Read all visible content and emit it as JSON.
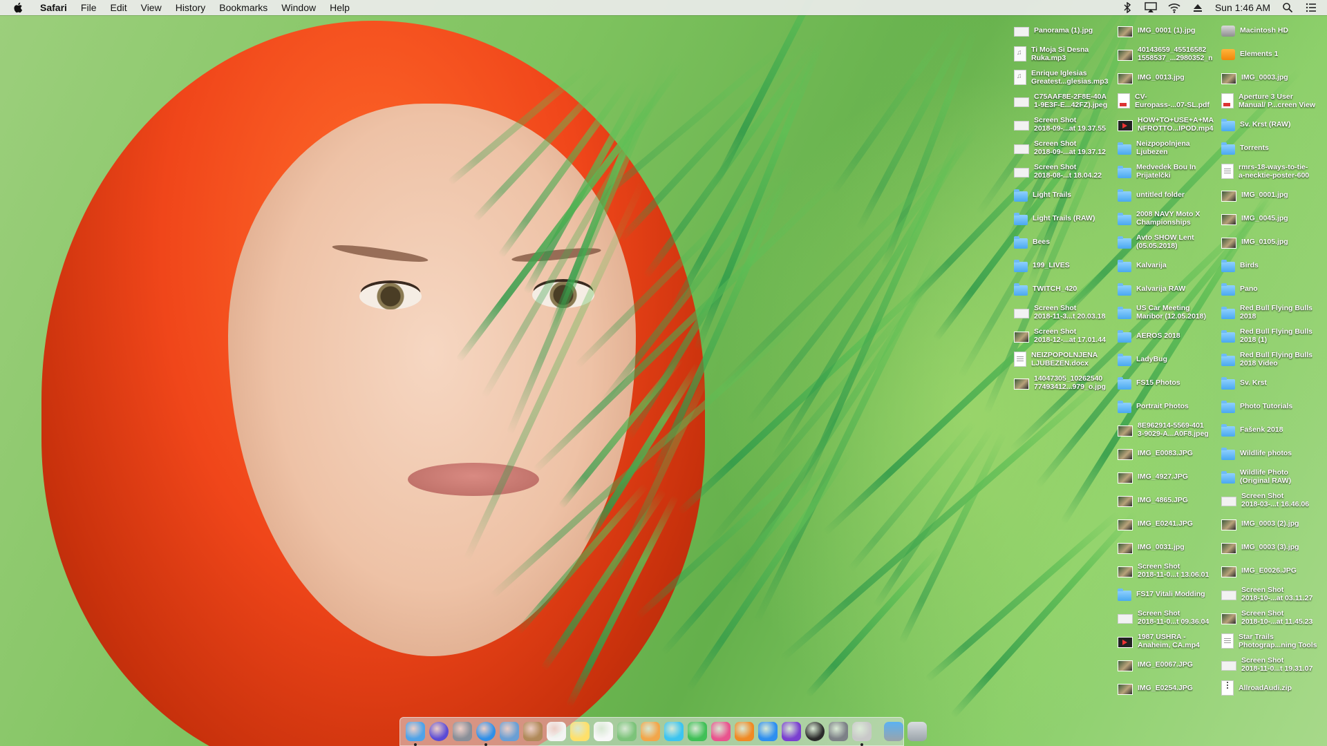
{
  "menubar": {
    "apple_icon": "apple-icon",
    "app_name": "Safari",
    "menus": [
      "File",
      "Edit",
      "View",
      "History",
      "Bookmarks",
      "Window",
      "Help"
    ],
    "status_icons": [
      "bluetooth-icon",
      "airplay-icon",
      "wifi-icon",
      "eject-icon",
      "spotlight-icon",
      "notification-center-icon"
    ],
    "clock": "Sun 1:46 AM"
  },
  "desktop": {
    "col1": [
      {
        "label": "Panorama (1).jpg",
        "icon": "shot"
      },
      {
        "label": "Ti Moja Si Desna\nRuka.mp3",
        "icon": "audio"
      },
      {
        "label": "Enrique Iglesias\nGreatest...glesias.mp3",
        "icon": "audio"
      },
      {
        "label": "C75AAF8E-2F8E-40A\n1-9E3F-E...42FZ).jpeg",
        "icon": "shot"
      },
      {
        "label": "Screen Shot\n2018-09-...at 19.37.55",
        "icon": "shot"
      },
      {
        "label": "Screen Shot\n2018-09-...at 19.37.12",
        "icon": "shot"
      },
      {
        "label": "Screen Shot\n2018-08-...t 18.04.22",
        "icon": "shot"
      },
      {
        "label": "Light Trails",
        "icon": "folder"
      },
      {
        "label": "Light Trails (RAW)",
        "icon": "folder"
      },
      {
        "label": "Bees",
        "icon": "folder"
      },
      {
        "label": "199_LIVES",
        "icon": "folder"
      },
      {
        "label": "TWITCH_420",
        "icon": "folder"
      },
      {
        "label": "Screen Shot\n2018-11-3...t 20.03.18",
        "icon": "shot"
      },
      {
        "label": "Screen Shot\n2018-12-...at 17.01.44",
        "icon": "image"
      },
      {
        "label": "NEIZPOPOLNJENA\nLJUBEZEN.docx",
        "icon": "doc"
      },
      {
        "label": "14047305_10262540\n77493412...979_o.jpg",
        "icon": "image"
      }
    ],
    "col2": [
      {
        "label": "IMG_0001 (1).jpg",
        "icon": "image"
      },
      {
        "label": "40143659_45516582\n1558537_...2980352_n",
        "icon": "image"
      },
      {
        "label": "IMG_0013.jpg",
        "icon": "image"
      },
      {
        "label": "CV-\nEuropass-...07-SL.pdf",
        "icon": "pdf"
      },
      {
        "label": "HOW+TO+USE+A+MA\nNFROTTO...IPOD.mp4",
        "icon": "video"
      },
      {
        "label": "Neizpopolnjena\nLjubezen",
        "icon": "folder"
      },
      {
        "label": "Medvedek Bou In\nPrijatelčki",
        "icon": "folder"
      },
      {
        "label": "untitled folder",
        "icon": "folder"
      },
      {
        "label": "2008 NAVY Moto X\nChampionships",
        "icon": "folder"
      },
      {
        "label": "Avto SHOW Lent\n(05.05.2018)",
        "icon": "folder"
      },
      {
        "label": "Kalvarija",
        "icon": "folder"
      },
      {
        "label": "Kalvarija RAW",
        "icon": "folder"
      },
      {
        "label": "US Car Meeting\nMaribor (12.05.2018)",
        "icon": "folder"
      },
      {
        "label": "AEROS 2018",
        "icon": "folder"
      },
      {
        "label": "LadyBug",
        "icon": "folder"
      },
      {
        "label": "FS15 Photos",
        "icon": "folder"
      },
      {
        "label": "Portrait Photos",
        "icon": "folder"
      },
      {
        "label": "8E962914-5569-401\n3-9029-A...A0F8.jpeg",
        "icon": "image"
      },
      {
        "label": "IMG_E0083.JPG",
        "icon": "image"
      },
      {
        "label": "IMG_4927.JPG",
        "icon": "image"
      },
      {
        "label": "IMG_4865.JPG",
        "icon": "image"
      },
      {
        "label": "IMG_E0241.JPG",
        "icon": "image"
      },
      {
        "label": "IMG_0031.jpg",
        "icon": "image"
      },
      {
        "label": "Screen Shot\n2018-11-0...t 13.06.01",
        "icon": "image"
      },
      {
        "label": "FS17 Vitali Modding",
        "icon": "folder"
      },
      {
        "label": "Screen Shot\n2018-11-0...t 09.36.04",
        "icon": "shot"
      },
      {
        "label": "1987 USHRA -\nAnaheim, CA.mp4",
        "icon": "video"
      },
      {
        "label": "IMG_E0067.JPG",
        "icon": "image"
      },
      {
        "label": "IMG_E0254.JPG",
        "icon": "image"
      }
    ],
    "col3": [
      {
        "label": "Macintosh HD",
        "icon": "disk"
      },
      {
        "label": "Elements 1",
        "icon": "orange"
      },
      {
        "label": "IMG_0003.jpg",
        "icon": "image"
      },
      {
        "label": "Aperture 3 User\nManual/ P...creen View",
        "icon": "pdf"
      },
      {
        "label": "Sv. Krst (RAW)",
        "icon": "folder"
      },
      {
        "label": "Torrents",
        "icon": "folder"
      },
      {
        "label": "rmrs-18-ways-to-tie-\na-necktie-poster-600",
        "icon": "doc"
      },
      {
        "label": "IMG_0001.jpg",
        "icon": "image"
      },
      {
        "label": "IMG_0045.jpg",
        "icon": "image"
      },
      {
        "label": "IMG_0105.jpg",
        "icon": "image"
      },
      {
        "label": "Birds",
        "icon": "folder"
      },
      {
        "label": "Pano",
        "icon": "folder"
      },
      {
        "label": "Red Bull Flying Bulls\n2018",
        "icon": "folder"
      },
      {
        "label": "Red Bull Flying Bulls\n2018 (1)",
        "icon": "folder"
      },
      {
        "label": "Red Bull Flying Bulls\n2018 Video",
        "icon": "folder"
      },
      {
        "label": "Sv. Krst",
        "icon": "folder"
      },
      {
        "label": "Photo Tutorials",
        "icon": "folder"
      },
      {
        "label": "Fašenk 2018",
        "icon": "folder"
      },
      {
        "label": "Wildlife photos",
        "icon": "folder"
      },
      {
        "label": "Wildlife Photo\n(Original RAW)",
        "icon": "folder"
      },
      {
        "label": "Screen Shot\n2018-03-...t 16.46.06",
        "icon": "shot"
      },
      {
        "label": "IMG_0003 (2).jpg",
        "icon": "image"
      },
      {
        "label": "IMG_0003 (3).jpg",
        "icon": "image"
      },
      {
        "label": "IMG_E0026.JPG",
        "icon": "image"
      },
      {
        "label": "Screen Shot\n2018-10-...at 03.11.27",
        "icon": "shot"
      },
      {
        "label": "Screen Shot\n2018-10-...at 11.45.23",
        "icon": "image"
      },
      {
        "label": "Star Trails\nPhotograp...ning Tools",
        "icon": "doc"
      },
      {
        "label": "Screen Shot\n2018-11-0...t 19.31.07",
        "icon": "shot"
      },
      {
        "label": "AllroadAudi.zip",
        "icon": "zip"
      }
    ]
  },
  "dock": {
    "apps": [
      {
        "name": "finder-icon",
        "color": "#4fa3e8",
        "running": true
      },
      {
        "name": "siri-icon",
        "color": "#5a4bd6",
        "running": false
      },
      {
        "name": "launchpad-icon",
        "color": "#8a8f98",
        "running": false
      },
      {
        "name": "safari-icon",
        "color": "#2f8fe8",
        "running": true
      },
      {
        "name": "preview-icon",
        "color": "#6a9fd4",
        "running": false
      },
      {
        "name": "contacts-icon",
        "color": "#b08a5a",
        "running": false
      },
      {
        "name": "calendar-icon",
        "color": "#f4f4f4",
        "running": false
      },
      {
        "name": "notes-icon",
        "color": "#ffe06a",
        "running": false
      },
      {
        "name": "reminders-icon",
        "color": "#f8f8f8",
        "running": false
      },
      {
        "name": "maps-icon",
        "color": "#7cc37a",
        "running": false
      },
      {
        "name": "photos-icon",
        "color": "#f2a64a",
        "running": false
      },
      {
        "name": "messages-icon",
        "color": "#3cc4f0",
        "running": false
      },
      {
        "name": "facetime-icon",
        "color": "#40c057",
        "running": false
      },
      {
        "name": "itunes-icon",
        "color": "#e9548e",
        "running": false
      },
      {
        "name": "ibooks-icon",
        "color": "#f08a24",
        "running": false
      },
      {
        "name": "app-store-icon",
        "color": "#2e8ff0",
        "running": false
      },
      {
        "name": "affinity-icon",
        "color": "#7a3fd0",
        "running": false
      },
      {
        "name": "camera-raw-icon",
        "color": "#2a2a2a",
        "running": false
      },
      {
        "name": "system-preferences-icon",
        "color": "#7d8187",
        "running": false
      },
      {
        "name": "script-editor-icon",
        "color": "#c9c9c9",
        "running": true
      }
    ],
    "right": [
      {
        "name": "downloads-folder-icon",
        "color": "#5bb2f2"
      },
      {
        "name": "trash-icon",
        "color": "#d9dde0"
      }
    ]
  }
}
